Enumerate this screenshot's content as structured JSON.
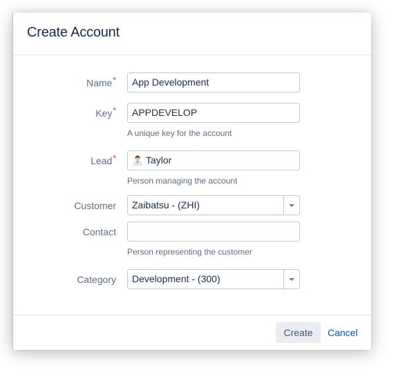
{
  "dialog": {
    "title": "Create Account",
    "required_marker": "*"
  },
  "form": {
    "name": {
      "label": "Name",
      "value": "App Development"
    },
    "key": {
      "label": "Key",
      "value": "APPDEVELOP",
      "help": "A unique key for the account"
    },
    "lead": {
      "label": "Lead",
      "value": "Taylor",
      "help": "Person managing the account",
      "avatar_icon": "user-avatar-icon"
    },
    "customer": {
      "label": "Customer",
      "value": "Zaibatsu - (ZHI)"
    },
    "contact": {
      "label": "Contact",
      "value": "",
      "help": "Person representing the customer"
    },
    "category": {
      "label": "Category",
      "value": "Development - (300)"
    }
  },
  "footer": {
    "create_label": "Create",
    "cancel_label": "Cancel"
  },
  "colors": {
    "required": "#de350b",
    "link": "#0052cc",
    "button_bg": "#ebecf0",
    "title": "#172b4d"
  }
}
